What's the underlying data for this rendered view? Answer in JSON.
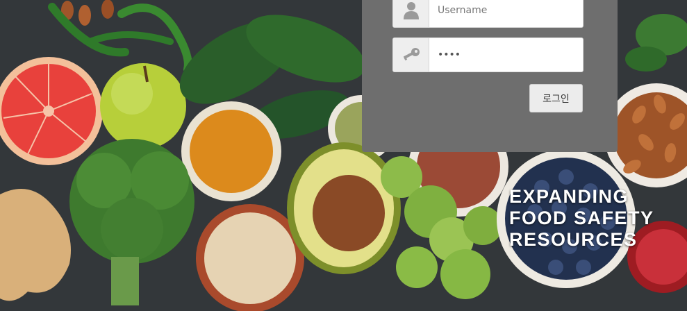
{
  "login": {
    "username_placeholder": "Username",
    "password_value": "••••",
    "login_button_label": "로그인"
  },
  "hero": {
    "tagline": "EXPANDING\nFOOD SAFETY\nRESOURCES"
  },
  "icons": {
    "username": "user-icon",
    "password": "key-icon"
  },
  "colors": {
    "panel_bg": "#6e6e6e",
    "button_bg": "#ececec",
    "tagline_text": "#ffffff"
  }
}
